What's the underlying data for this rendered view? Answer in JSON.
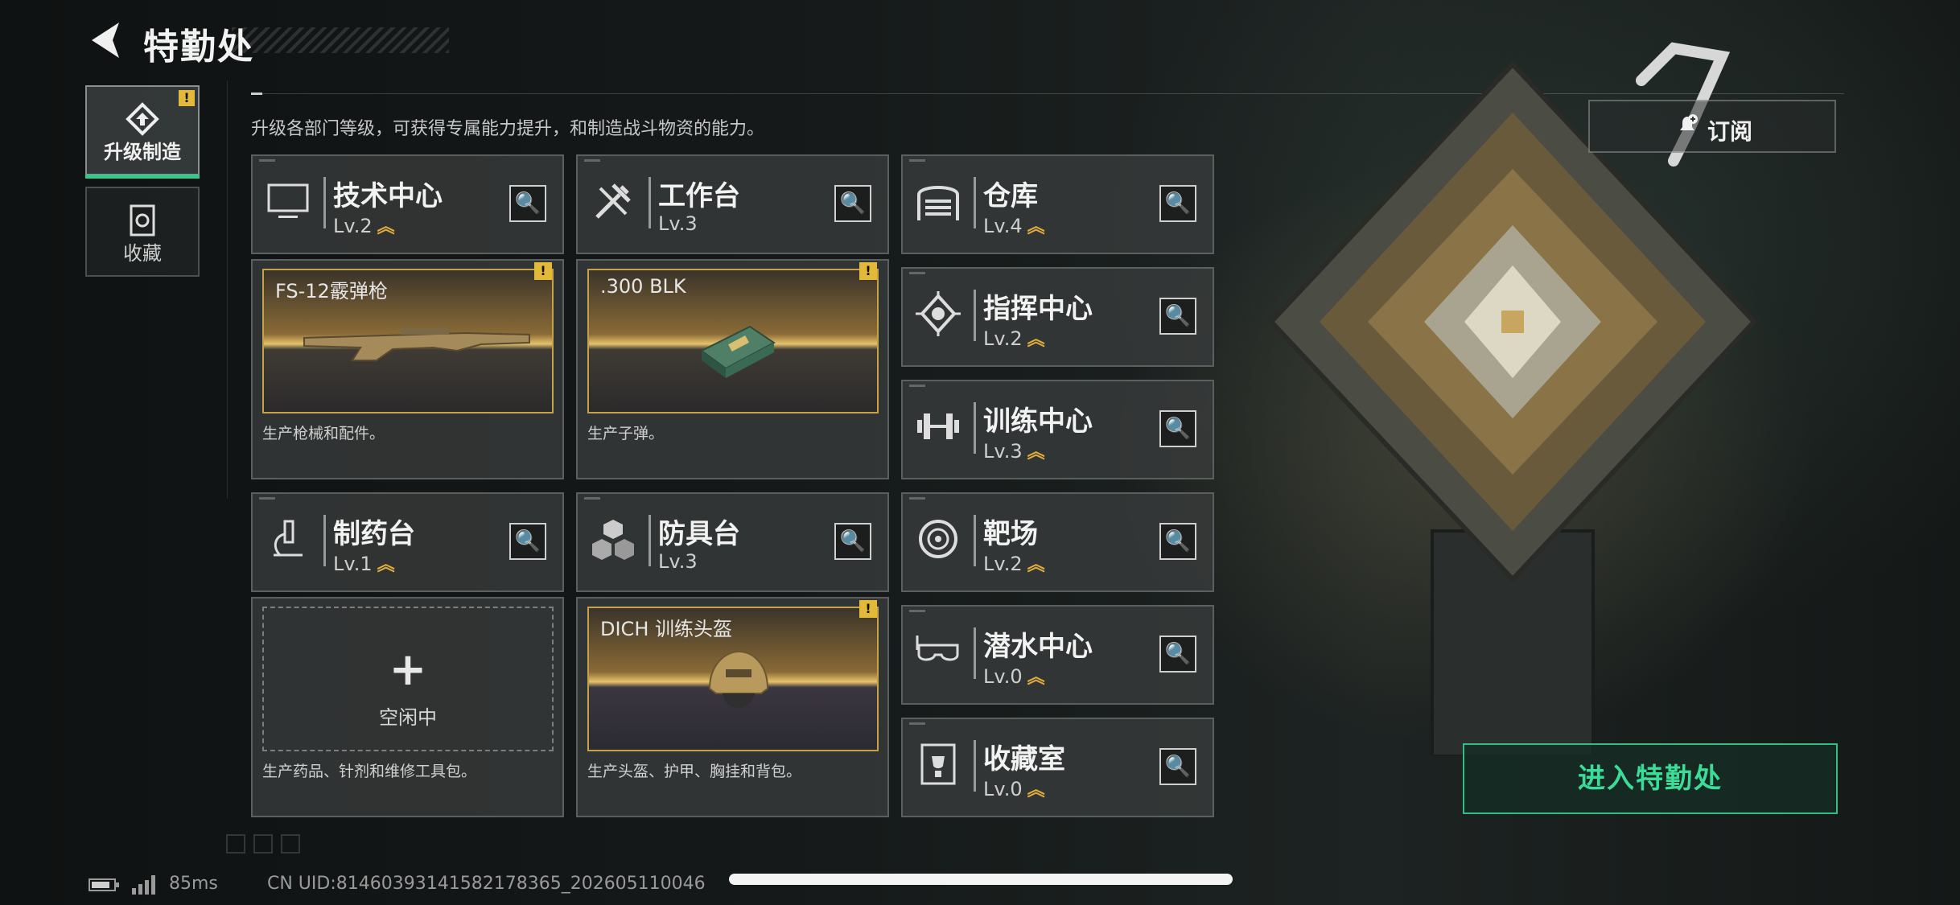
{
  "header": {
    "title": "特勤处",
    "description": "升级各部门等级，可获得专属能力提升，和制造战斗物资的能力。"
  },
  "tabs": [
    {
      "label": "升级制造",
      "icon": "upgrade-icon",
      "active": true,
      "alert": "!"
    },
    {
      "label": "收藏",
      "icon": "collection-icon",
      "active": false
    }
  ],
  "departments": {
    "tech_center": {
      "name": "技术中心",
      "level": "Lv.2",
      "icon": "monitor-icon"
    },
    "workbench": {
      "name": "工作台",
      "level": "Lv.3",
      "icon": "tools-icon"
    },
    "warehouse": {
      "name": "仓库",
      "level": "Lv.4",
      "icon": "garage-icon"
    },
    "command_center": {
      "name": "指挥中心",
      "level": "Lv.2",
      "icon": "chip-icon"
    },
    "training_center": {
      "name": "训练中心",
      "level": "Lv.3",
      "icon": "dumbbell-icon"
    },
    "pharmacy": {
      "name": "制药台",
      "level": "Lv.1",
      "icon": "microscope-icon"
    },
    "armor_bench": {
      "name": "防具台",
      "level": "Lv.3",
      "icon": "cubes-icon"
    },
    "shooting_range": {
      "name": "靶场",
      "level": "Lv.2",
      "icon": "target-icon"
    },
    "diving_center": {
      "name": "潜水中心",
      "level": "Lv.0",
      "icon": "goggles-icon"
    },
    "collection_room": {
      "name": "收藏室",
      "level": "Lv.0",
      "icon": "trophy-icon"
    }
  },
  "productions": {
    "tech_center": {
      "item": "FS-12霰弹枪",
      "desc": "生产枪械和配件。",
      "alert": "!"
    },
    "workbench": {
      "item": ".300 BLK",
      "desc": "生产子弹。",
      "alert": "!"
    },
    "pharmacy": {
      "item": "",
      "plus": "+",
      "idle": "空闲中",
      "desc": "生产药品、针剂和维修工具包。"
    },
    "armor_bench": {
      "item": "DICH 训练头盔",
      "desc": "生产头盔、护甲、胸挂和背包。",
      "alert": "!"
    }
  },
  "level_up_glyph": "︽",
  "search_glyph": "🔍",
  "subscribe": {
    "label": "订阅",
    "icon": "bell-plus-icon"
  },
  "enter_button": {
    "label": "进入特勤处"
  },
  "footer": {
    "ping": "85ms",
    "uid": "CN UID:8146039314158217836​5_202605110046"
  },
  "colors": {
    "accent_green": "#34c98a",
    "gold": "#e0ad3b",
    "warning": "#e3b93a"
  }
}
